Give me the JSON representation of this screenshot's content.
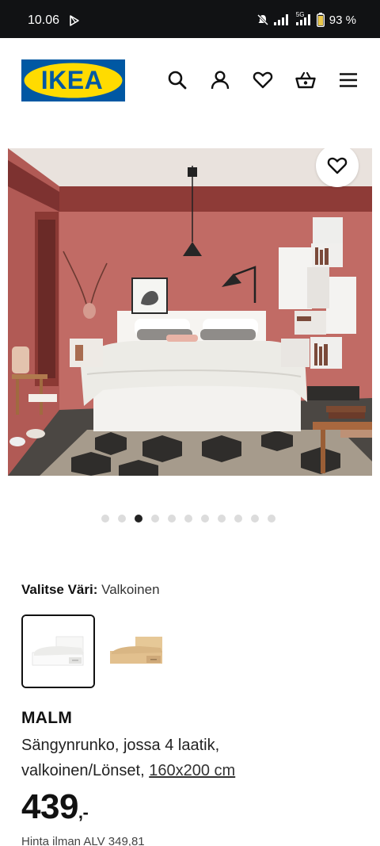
{
  "status_bar": {
    "time": "10.06",
    "battery": "93 %",
    "network_tag": "5G"
  },
  "header": {
    "logo_text": "IKEA",
    "icons": [
      "search-icon",
      "account-icon",
      "heart-icon",
      "basket-icon",
      "menu-icon"
    ]
  },
  "gallery": {
    "total_images": 11,
    "active_index": 2
  },
  "color_picker": {
    "label": "Valitse Väri:",
    "selected_value": "Valkoinen",
    "options": [
      "white-bed-thumbnail",
      "oak-bed-thumbnail"
    ]
  },
  "product": {
    "name": "MALM",
    "desc_line1": "Sängynrunko, jossa 4 laatik,",
    "desc_line2": "valkoinen/Lönset,",
    "size_link": "160x200 cm",
    "price_main": "439",
    "price_suffix": ",-",
    "price_note": "Hinta ilman ALV 349,81"
  },
  "colors": {
    "ikea_blue": "#0058a3",
    "ikea_yellow": "#ffdb00",
    "wall": "#c06a64"
  }
}
